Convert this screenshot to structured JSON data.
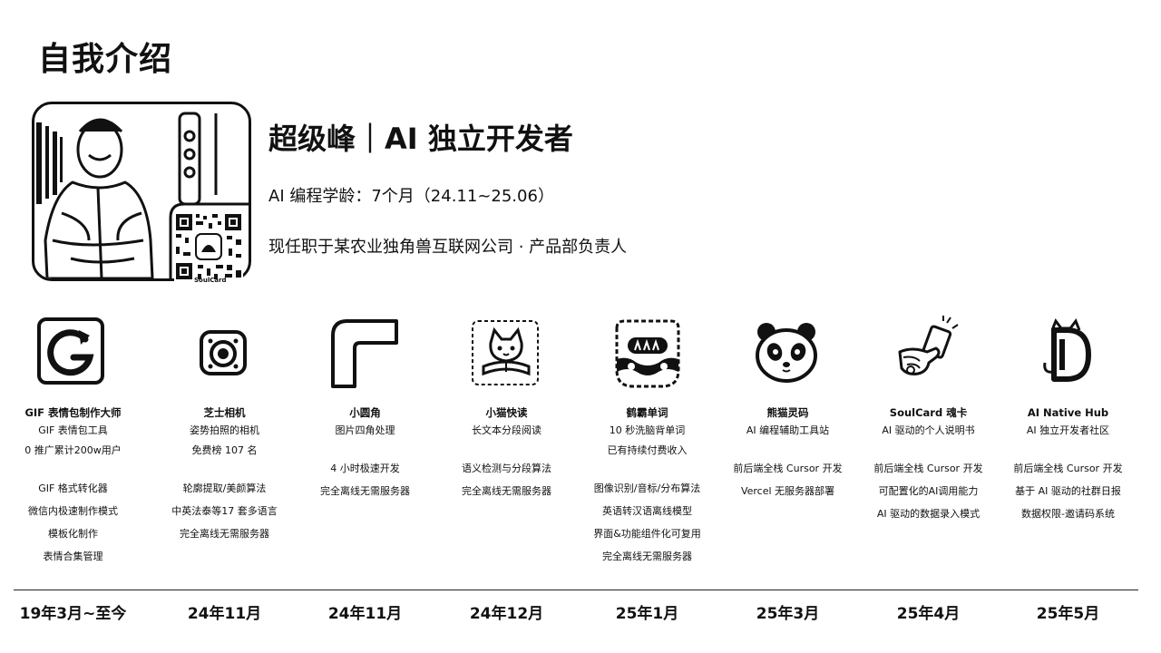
{
  "page": {
    "title": "自我介绍",
    "headline": "超级峰｜AI 独立开发者",
    "coding_age": "AI 编程学龄：7个月（24.11~25.06）",
    "job": "现任职于某农业独角兽互联网公司 · 产品部负责人",
    "qr_caption": "SoulCard"
  },
  "projects": [
    {
      "icon": "gif-g-icon",
      "name": "GIF 表情包制作大师",
      "desc": [
        "GIF 表情包工具",
        "0 推广累计200w用户"
      ],
      "features": [
        "GIF 格式转化器",
        "微信内极速制作模式",
        "模板化制作",
        "表情合集管理"
      ],
      "date": "19年3月~至今"
    },
    {
      "icon": "camera-icon",
      "name": "芝士相机",
      "desc": [
        "姿势拍照的相机",
        "免费榜 107 名"
      ],
      "features": [
        "轮廓提取/美颜算法",
        "中英法泰等17 套多语言",
        "完全离线无需服务器"
      ],
      "date": "24年11月"
    },
    {
      "icon": "rounded-corner-icon",
      "name": "小圆角",
      "desc": [
        "图片四角处理"
      ],
      "features": [
        "4 小时极速开发",
        "完全离线无需服务器"
      ],
      "date": "24年11月"
    },
    {
      "icon": "cat-reading-icon",
      "name": "小猫快读",
      "desc": [
        "长文本分段阅读"
      ],
      "features": [
        "语义检测与分段算法",
        "完全离线无需服务器"
      ],
      "date": "24年12月"
    },
    {
      "icon": "robot-face-icon",
      "name": "鹤霸单词",
      "desc": [
        "10 秒洗脑背单词",
        "已有持续付费收入"
      ],
      "features": [
        "图像识别/音标/分布算法",
        "英语转汉语离线模型",
        "界面&功能组件化可复用",
        "完全离线无需服务器"
      ],
      "date": "25年1月"
    },
    {
      "icon": "panda-icon",
      "name": "熊猫灵码",
      "desc": [
        "AI 编程辅助工具站"
      ],
      "features": [
        "前后端全栈 Cursor 开发",
        "Vercel 无服务器部署"
      ],
      "date": "25年3月"
    },
    {
      "icon": "hand-card-icon",
      "name": "SoulCard 魂卡",
      "desc": [
        "AI 驱动的个人说明书"
      ],
      "features": [
        "前后端全栈 Cursor 开发",
        "可配置化的AI调用能力",
        "AI 驱动的数据录入模式"
      ],
      "date": "25年4月"
    },
    {
      "icon": "d-cat-logo-icon",
      "name": "AI Native Hub",
      "desc": [
        "AI 独立开发者社区"
      ],
      "features": [
        "前后端全栈 Cursor 开发",
        "基于 AI 驱动的社群日报",
        "数据权限-邀请码系统"
      ],
      "date": "25年5月"
    }
  ]
}
